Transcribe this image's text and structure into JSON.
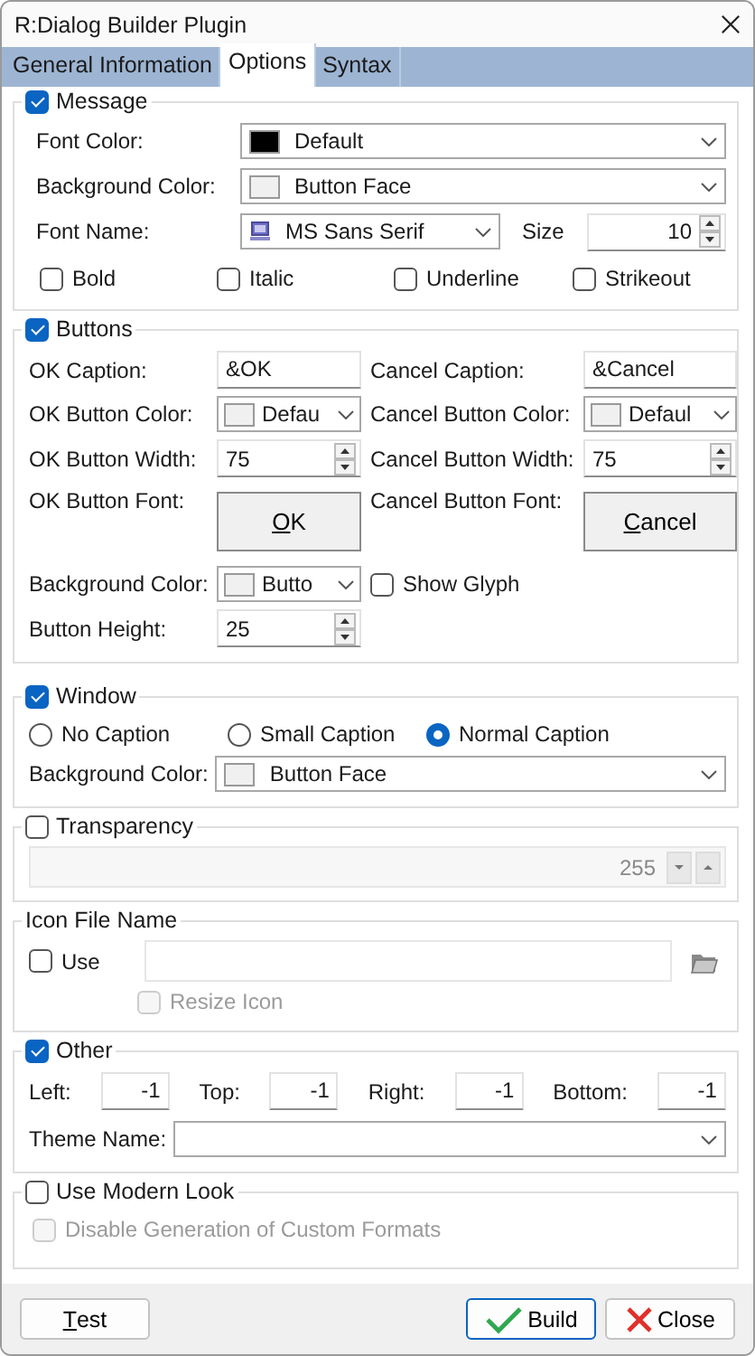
{
  "window": {
    "title": "R:Dialog Builder Plugin"
  },
  "tabs": [
    {
      "label": "General Information",
      "selected": false
    },
    {
      "label": "Options",
      "selected": true
    },
    {
      "label": "Syntax",
      "selected": false
    }
  ],
  "message": {
    "label": "Message",
    "checked": true,
    "font_color": {
      "label": "Font Color:",
      "value": "Default",
      "color": "#000000"
    },
    "background_color": {
      "label": "Background Color:",
      "value": "Button Face",
      "color": "#f0f0f0"
    },
    "font_name": {
      "label": "Font Name:",
      "value": "MS Sans Serif"
    },
    "size": {
      "label": "Size",
      "value": "10"
    },
    "styles": [
      {
        "label": "Bold",
        "checked": false
      },
      {
        "label": "Italic",
        "checked": false
      },
      {
        "label": "Underline",
        "checked": false
      },
      {
        "label": "Strikeout",
        "checked": false
      }
    ]
  },
  "buttons_group": {
    "label": "Buttons",
    "checked": true,
    "ok_caption": {
      "label": "OK Caption:",
      "value": "&OK"
    },
    "cancel_caption": {
      "label": "Cancel Caption:",
      "value": "&Cancel"
    },
    "ok_color": {
      "label": "OK Button Color:",
      "value": "Defau",
      "color": "#f0f0f0"
    },
    "cancel_color": {
      "label": "Cancel Button Color:",
      "value": "Defaul",
      "color": "#f0f0f0"
    },
    "ok_width": {
      "label": "OK Button Width:",
      "value": "75"
    },
    "cancel_width": {
      "label": "Cancel Button Width:",
      "value": "75"
    },
    "ok_font": {
      "label": "OK Button  Font:",
      "accel": "O",
      "rest": "K"
    },
    "cancel_font": {
      "label": "Cancel Button  Font:",
      "accel": "C",
      "rest": "ancel"
    },
    "background_color": {
      "label": "Background Color:",
      "value": "Butto",
      "color": "#f0f0f0"
    },
    "show_glyph": {
      "label": "Show Glyph",
      "checked": false
    },
    "button_height": {
      "label": "Button Height:",
      "value": "25"
    }
  },
  "window_group": {
    "label": "Window",
    "checked": true,
    "captions": [
      {
        "label": "No Caption",
        "selected": false
      },
      {
        "label": "Small Caption",
        "selected": false
      },
      {
        "label": "Normal Caption",
        "selected": true
      }
    ],
    "background_color": {
      "label": "Background Color:",
      "value": "Button Face",
      "color": "#f0f0f0"
    }
  },
  "transparency": {
    "label": "Transparency",
    "checked": false,
    "value": "255",
    "disabled": true
  },
  "icon_file": {
    "title": "Icon File Name",
    "use": {
      "label": "Use",
      "checked": false
    },
    "resize": {
      "label": "Resize Icon",
      "checked": false,
      "disabled": true
    }
  },
  "other": {
    "label": "Other",
    "checked": true,
    "margins": [
      {
        "label": "Left:",
        "value": "-1"
      },
      {
        "label": "Top:",
        "value": "-1"
      },
      {
        "label": "Right:",
        "value": "-1"
      },
      {
        "label": "Bottom:",
        "value": "-1"
      }
    ],
    "theme": {
      "label": "Theme Name:"
    }
  },
  "modern": {
    "label": "Use Modern Look",
    "checked": false,
    "disable_custom": {
      "label": "Disable Generation of Custom Formats",
      "checked": false,
      "disabled": true
    }
  },
  "actions": [
    {
      "kind": "test",
      "accel": "T",
      "rest": "est"
    },
    {
      "kind": "build",
      "label": "Build"
    },
    {
      "kind": "close",
      "label": "Close"
    }
  ]
}
